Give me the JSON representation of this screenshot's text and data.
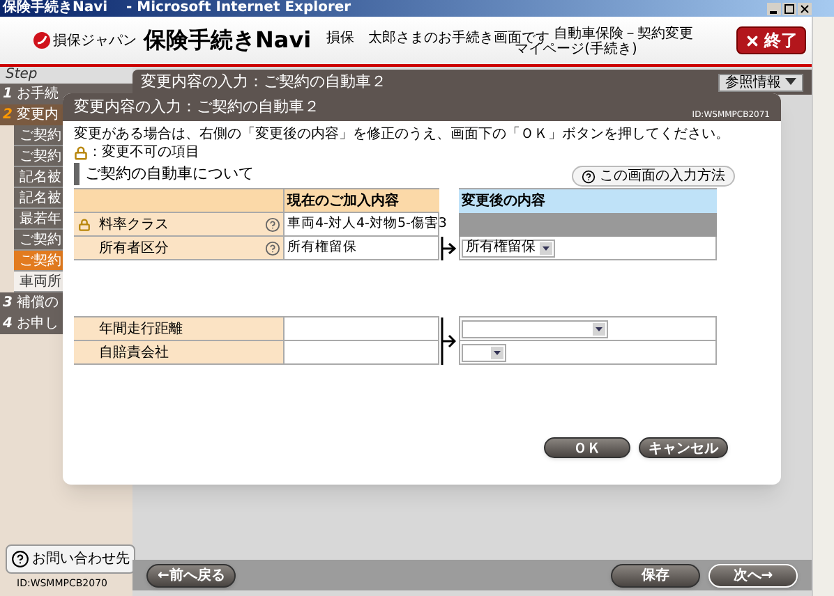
{
  "browser": {
    "title": "保険手続きNavi　 - Microsoft Internet Explorer"
  },
  "header": {
    "brand": "損保ジャパン",
    "app_name": "保険手続きNavi",
    "greeting": "損保　太郎さまのお手続き画面です",
    "context": "自動車保険－契約変更",
    "subcontext": "マイページ(手続き)",
    "exit_button": "終了"
  },
  "sidebar": {
    "heading": "Step",
    "steps": [
      {
        "number": "1",
        "label": "お手続",
        "selected": false
      },
      {
        "number": "2",
        "label": "変更内",
        "selected": true,
        "children": [
          {
            "label": "ご契約",
            "selected": false
          },
          {
            "label": "ご契約",
            "selected": false
          },
          {
            "label": "記名被",
            "selected": false
          },
          {
            "label": "記名被",
            "selected": false
          },
          {
            "label": "最若年",
            "selected": false
          },
          {
            "label": "ご契約",
            "selected": false
          },
          {
            "label": "ご契約",
            "selected": true
          },
          {
            "label": "車両所",
            "selected": false
          }
        ]
      },
      {
        "number": "3",
        "label": "補償の",
        "selected": false
      },
      {
        "number": "4",
        "label": "お申し",
        "selected": false
      }
    ]
  },
  "content": {
    "title": "変更内容の入力：ご契約の自動車２",
    "reference_button": "参照情報"
  },
  "dialog": {
    "title": "変更内容の入力：ご契約の自動車２",
    "screen_id": "ID:WSMMPCB2071",
    "instruction": "変更がある場合は、右側の「変更後の内容」を修正のうえ、画面下の「ＯＫ」ボタンを押してください。",
    "lock_note": "：変更不可の項目",
    "section_title": "ご契約の自動車について",
    "help_button": "この画面の入力方法",
    "current_header": "現在のご加入内容",
    "new_header": "変更後の内容",
    "groups": [
      {
        "rows": [
          {
            "label": "料率クラス",
            "locked": true,
            "help": true,
            "current": "車両4-対人4-対物5-傷害3",
            "kind": "fixed"
          },
          {
            "label": "所有者区分",
            "locked": false,
            "help": true,
            "current": "所有権留保",
            "kind": "select",
            "value": "所有権留保"
          }
        ]
      },
      {
        "rows": [
          {
            "label": "年間走行距離",
            "locked": false,
            "help": false,
            "kind": "select"
          },
          {
            "label": "自賠責会社",
            "locked": false,
            "help": false,
            "kind": "select"
          }
        ]
      }
    ],
    "ok_button": "ＯＫ",
    "cancel_button": "キャンセル"
  },
  "footer": {
    "contact_button": "お問い合わせ先",
    "screen_id": "ID:WSMMPCB2070",
    "back_button": "←前へ戻る",
    "save_button": "保存",
    "next_button": "次へ→"
  }
}
